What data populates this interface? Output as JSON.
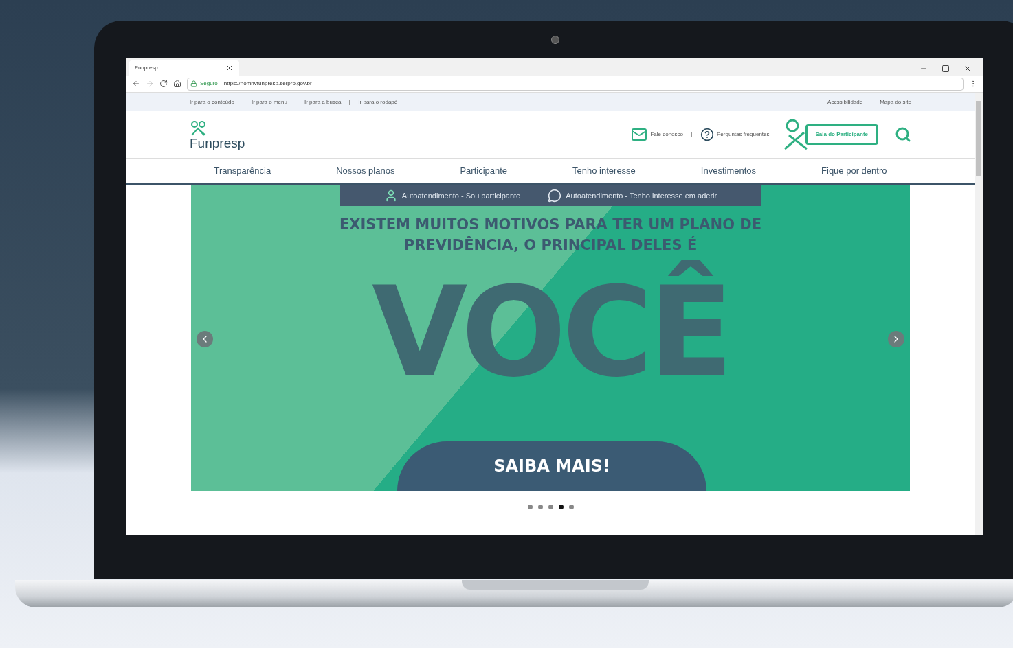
{
  "browser": {
    "tab_title": "Funpresp",
    "security": "Seguro",
    "url": "https://homnvfunpresp.serpro.gov.br"
  },
  "skip_links": [
    "Ir para o conteúdo",
    "Ir para o menu",
    "Ir para a busca",
    "Ir para o rodapé"
  ],
  "utility_links": [
    "Acessibilidade",
    "Mapa do site"
  ],
  "logo": "Funpresp",
  "header_links": [
    {
      "kind": "mail",
      "label": "Fale conosco"
    },
    {
      "kind": "help",
      "label": "Perguntas frequentes"
    }
  ],
  "participant_button": "Sala do Participante",
  "nav": [
    "Transparência",
    "Nossos planos",
    "Participante",
    "Tenho interesse",
    "Investimentos",
    "Fique por dentro"
  ],
  "banner": {
    "quick_links": [
      {
        "kind": "user",
        "label": "Autoatendimento - Sou participante"
      },
      {
        "kind": "chat",
        "label": "Autoatendimento - Tenho interesse em aderir"
      }
    ],
    "headline": [
      "EXISTEM MUITOS MOTIVOS PARA TER UM PLANO DE",
      "PREVIDÊNCIA, O PRINCIPAL DELES É"
    ],
    "big_word": "VOCÊ",
    "cta": "SAIBA MAIS!"
  },
  "carousel_dots": [
    {
      "selected": false
    },
    {
      "selected": false
    },
    {
      "selected": false
    },
    {
      "selected": true
    },
    {
      "selected": false
    }
  ]
}
